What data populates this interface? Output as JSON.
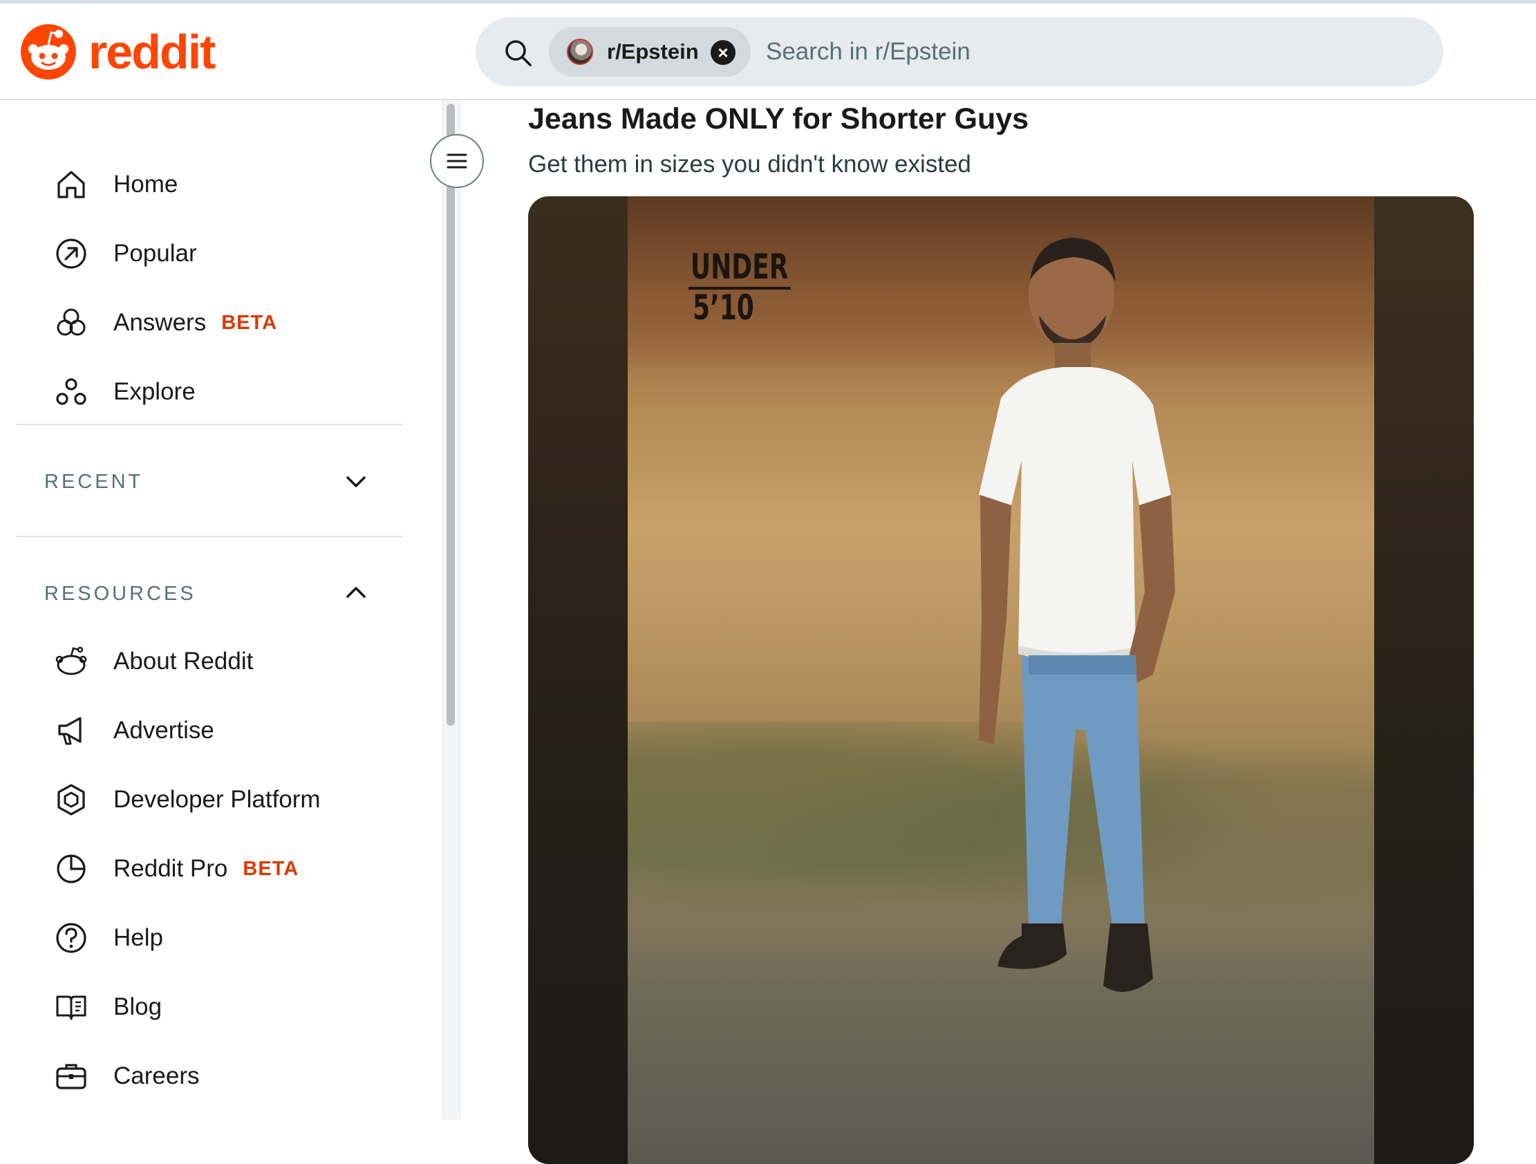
{
  "header": {
    "logo_text": "reddit",
    "search": {
      "chip_label": "r/Epstein",
      "placeholder": "Search in r/Epstein"
    }
  },
  "sidebar": {
    "main_items": [
      {
        "label": "Home",
        "icon": "home-icon"
      },
      {
        "label": "Popular",
        "icon": "popular-icon"
      },
      {
        "label": "Answers",
        "badge": "BETA",
        "icon": "answers-icon"
      },
      {
        "label": "Explore",
        "icon": "explore-icon"
      }
    ],
    "recent": {
      "title": "RECENT",
      "expanded": false
    },
    "resources": {
      "title": "RESOURCES",
      "expanded": true,
      "items": [
        {
          "label": "About Reddit",
          "icon": "reddit-snoo-icon"
        },
        {
          "label": "Advertise",
          "icon": "megaphone-icon"
        },
        {
          "label": "Developer Platform",
          "icon": "hexagon-icon"
        },
        {
          "label": "Reddit Pro",
          "badge": "BETA",
          "icon": "pie-chart-icon"
        },
        {
          "label": "Help",
          "icon": "help-icon"
        },
        {
          "label": "Blog",
          "icon": "book-icon"
        },
        {
          "label": "Careers",
          "icon": "briefcase-icon"
        }
      ]
    }
  },
  "ad": {
    "title": "Jeans Made ONLY for Shorter Guys",
    "subtitle": "Get them in sizes you didn't know existed",
    "image_text_line1": "UNDER",
    "image_text_line2": "5’10"
  },
  "colors": {
    "brand": "#ff4500",
    "beta": "#d93a00",
    "search_bg": "#e5ebee"
  }
}
